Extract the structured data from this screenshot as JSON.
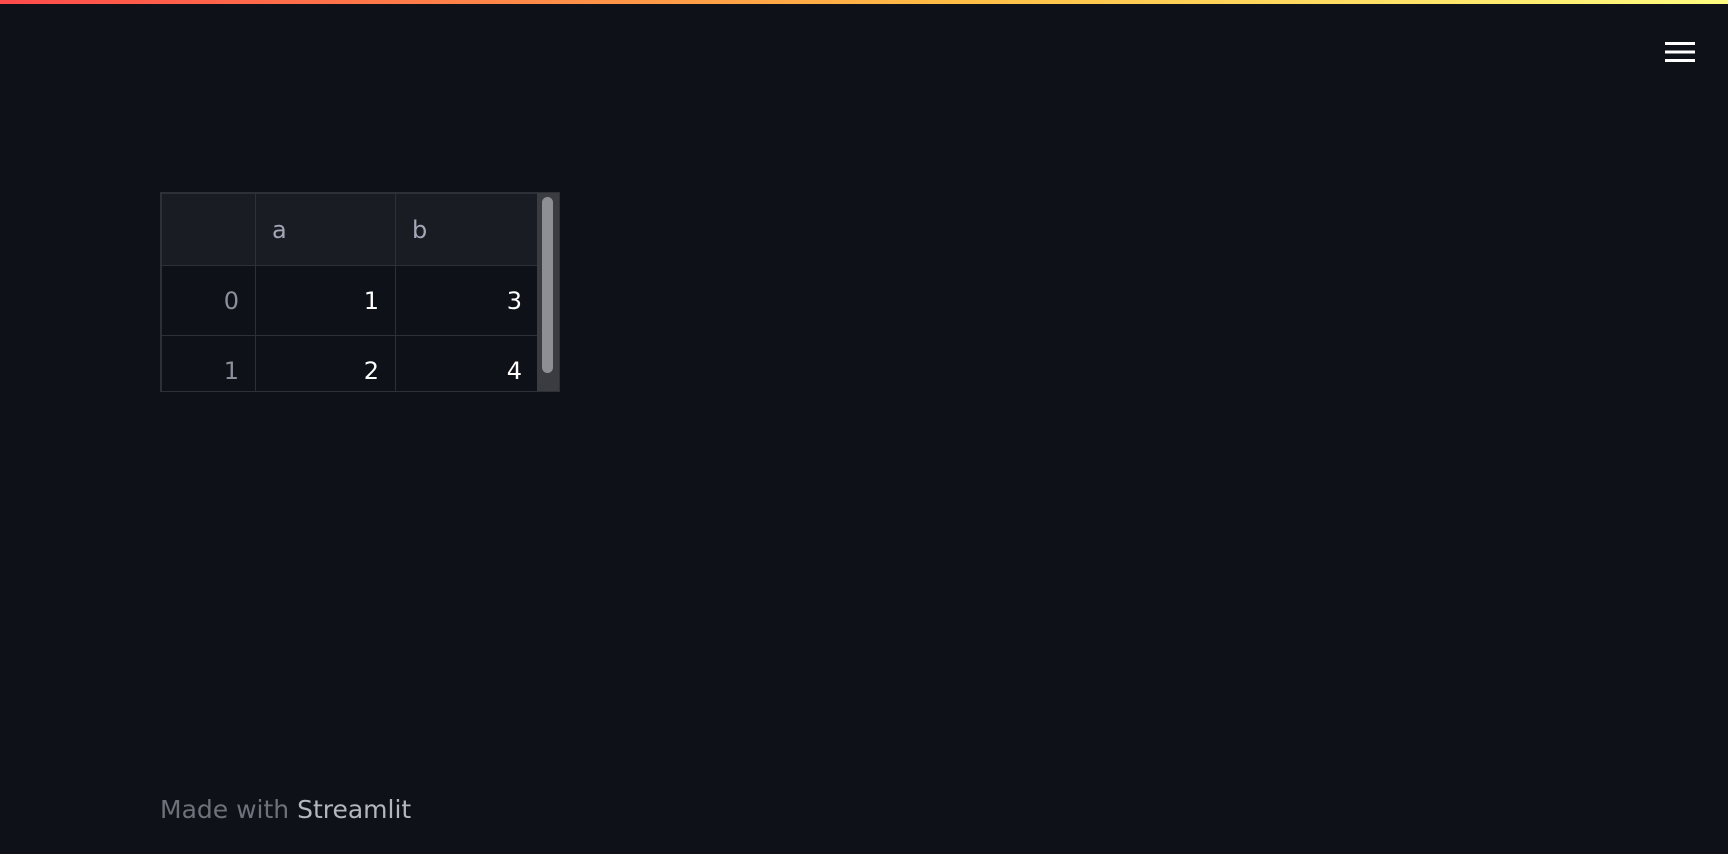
{
  "colors": {
    "background": "#0e1117",
    "accent_start": "#ff4b4b",
    "accent_end": "#fffd80",
    "border": "#2e3038",
    "header_bg": "#1a1c24"
  },
  "header": {
    "menu_icon": "hamburger-menu-icon"
  },
  "dataframe": {
    "columns": [
      "",
      "a",
      "b"
    ],
    "rows": [
      {
        "index": "0",
        "a": "1",
        "b": "3"
      },
      {
        "index": "1",
        "a": "2",
        "b": "4"
      }
    ]
  },
  "footer": {
    "prefix": "Made with ",
    "brand": "Streamlit"
  }
}
